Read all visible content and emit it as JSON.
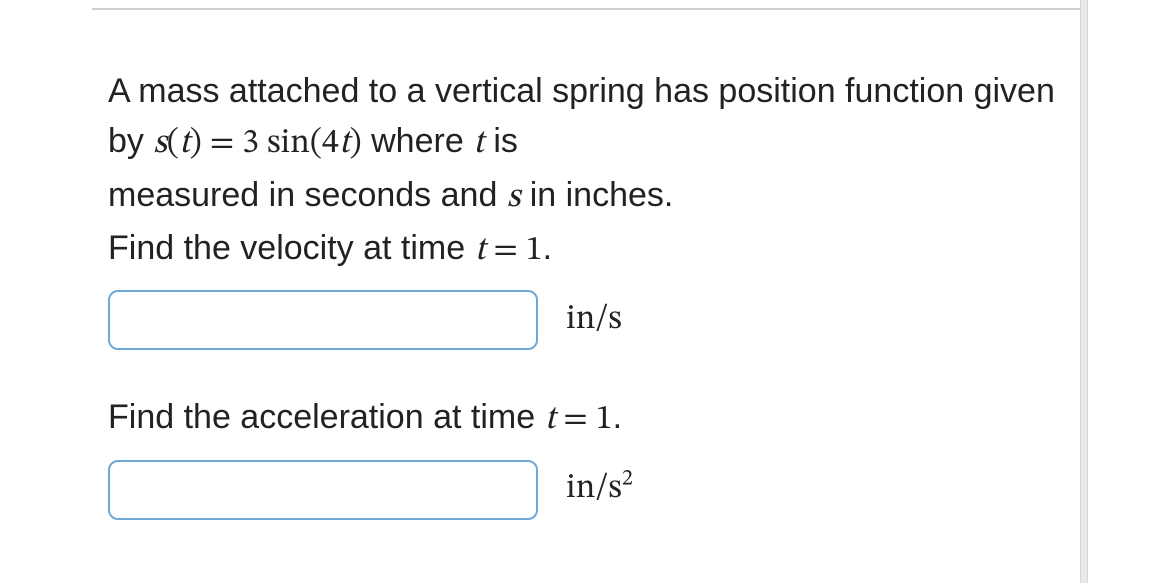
{
  "problem": {
    "intro_prefix": "A mass attached to a vertical spring has position function given by ",
    "eq_lhs_fn": "s",
    "eq_lhs_paren_open": "(",
    "eq_lhs_var": "t",
    "eq_lhs_paren_close": ")",
    "eq_eq": " = ",
    "eq_rhs_coeff": "3",
    "eq_rhs_space": " ",
    "eq_rhs_fn": "sin",
    "eq_rhs_paren_open": "(",
    "eq_rhs_arg_coef": "4",
    "eq_rhs_arg_var": "t",
    "eq_rhs_paren_close": ")",
    "intro_where": " where ",
    "intro_var_t": "t",
    "intro_is": " is",
    "intro_line2_prefix": "measured in seconds and ",
    "intro_var_s": "s",
    "intro_line2_suffix": " in inches.",
    "q1_prefix": "Find the velocity at time ",
    "q1_var": "t",
    "q1_eq": " = ",
    "q1_val": "1",
    "q1_period": ".",
    "q1_unit": "in/s",
    "q2_prefix": "Find the acceleration at time ",
    "q2_var": "t",
    "q2_eq": " = ",
    "q2_val": "1",
    "q2_period": ".",
    "q2_unit_base": "in/s",
    "q2_unit_exp": "2"
  },
  "inputs": {
    "velocity_value": "",
    "acceleration_value": ""
  }
}
